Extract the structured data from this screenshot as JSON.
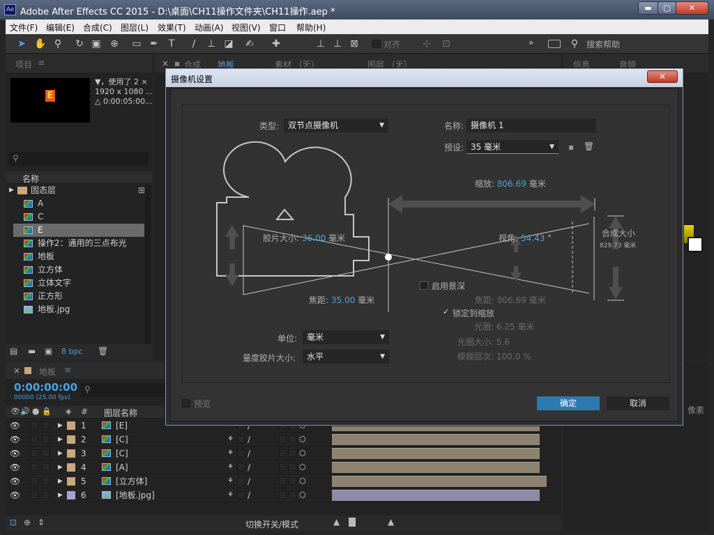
{
  "window": {
    "title": "Adobe After Effects CC 2015 - D:\\桌面\\CH11操作文件夹\\CH11操作.aep *",
    "app_icon": "Ae",
    "min": "▬",
    "max": "▢",
    "close": "✕"
  },
  "menu": [
    "文件(F)",
    "编辑(E)",
    "合成(C)",
    "图层(L)",
    "效果(T)",
    "动画(A)",
    "视图(V)",
    "窗口",
    "帮助(H)"
  ],
  "toolbar": {
    "align_label": "对齐",
    "search_help": "搜索帮助",
    "overflow": "»"
  },
  "project_panel": {
    "tab": "项目",
    "footage_info": [
      "▼，使用了 2 ×",
      "1920 x 1080  ...",
      "△ 0:00:05:00..."
    ],
    "thumb_letter": "E",
    "name_header": "名称",
    "search_placeholder": "",
    "items": [
      {
        "label": "固态层",
        "type": "folder"
      },
      {
        "label": "A"
      },
      {
        "label": "C"
      },
      {
        "label": "E",
        "selected": true
      },
      {
        "label": "操作2：通用的三点布光"
      },
      {
        "label": "地板"
      },
      {
        "label": "立方体"
      },
      {
        "label": "立体文字"
      },
      {
        "label": "正方形"
      },
      {
        "label": "地板.jpg",
        "type": "image"
      }
    ],
    "bpc": "8 bpc"
  },
  "comp_panel": {
    "tab_comp": "合成",
    "tab_comp_name": "地板",
    "tab_footage": "素材 （无）",
    "tab_layer": "图层 （无）"
  },
  "right_panel": {
    "tab_info": "信息",
    "tab_audio": "音频",
    "pixel_label": "像素"
  },
  "dialog": {
    "title": "摄像机设置",
    "close": "✕",
    "type_label": "类型:",
    "type_value": "双节点摄像机",
    "name_label": "名称:",
    "name_value": "摄像机 1",
    "preset_label": "预设:",
    "preset_value": "35 毫米",
    "zoom_label": "缩放:",
    "zoom_value": "806.69",
    "zoom_unit": "毫米",
    "film_size_label": "胶片大小:",
    "film_size_value": "36.00",
    "film_size_unit": "毫米",
    "angle_label": "视角:",
    "angle_value": "54.43",
    "angle_unit": "°",
    "comp_size_label": "合成大小",
    "comp_size_value": "829.73 毫米",
    "focal_label": "焦距:",
    "focal_value": "35.00",
    "focal_unit": "毫米",
    "dof_label": "启用景深",
    "focus_dist_label": "焦距:",
    "focus_dist_value": "806.69",
    "focus_dist_unit": "毫米",
    "lock_label": "锁定到缩放",
    "aperture_label": "光圈:",
    "aperture_value": "6.25 毫米",
    "fstop_label": "光圈大小:",
    "fstop_value": "5.6",
    "blur_label": "模糊层次:",
    "blur_value": "100.0 %",
    "unit_label": "单位:",
    "unit_value": "毫米",
    "measure_label": "量度胶片大小:",
    "measure_value": "水平",
    "preview_label": "预览",
    "ok": "确定",
    "cancel": "取消"
  },
  "timeline": {
    "tab": "地板",
    "timecode": "0:00:00:00",
    "fps": "00000 (25.00 fps)",
    "col_num": "#",
    "col_name": "图层名称",
    "footer_toggle": "切换开关/模式",
    "layers": [
      {
        "num": "1",
        "name": "[E]"
      },
      {
        "num": "2",
        "name": "[C]"
      },
      {
        "num": "3",
        "name": "[C]"
      },
      {
        "num": "4",
        "name": "[A]"
      },
      {
        "num": "5",
        "name": "[立方体]"
      },
      {
        "num": "6",
        "name": "[地板.jpg]"
      }
    ]
  },
  "colors": {
    "accent": "#2d7ab0",
    "layer_label": "#c9a87c",
    "bar": "#8e8270",
    "timecode": "#4aa3e0"
  }
}
